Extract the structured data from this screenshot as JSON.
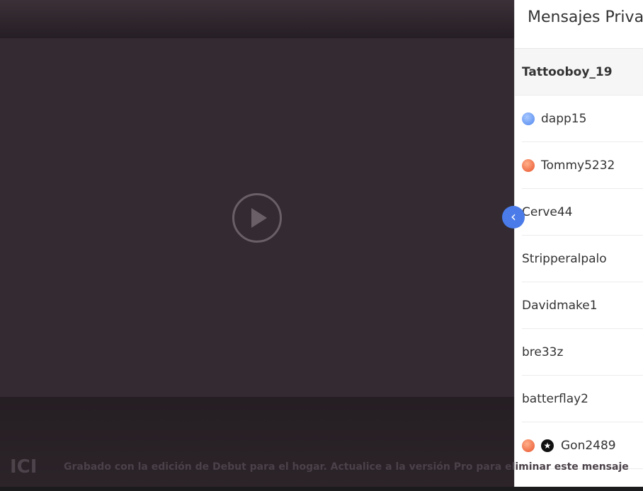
{
  "panel": {
    "title": "Mensajes Privados",
    "items": [
      {
        "name": "Tattooboy_19",
        "active": true,
        "dot": null,
        "badge": null
      },
      {
        "name": "dapp15",
        "active": false,
        "dot": "blue",
        "badge": null
      },
      {
        "name": "Tommy5232",
        "active": false,
        "dot": "orange",
        "badge": null
      },
      {
        "name": "Cerve44",
        "active": false,
        "dot": null,
        "badge": null
      },
      {
        "name": "Stripperalpalo",
        "active": false,
        "dot": null,
        "badge": null
      },
      {
        "name": "Davidmake1",
        "active": false,
        "dot": null,
        "badge": null
      },
      {
        "name": "bre33z",
        "active": false,
        "dot": null,
        "badge": null
      },
      {
        "name": "batterflay2",
        "active": false,
        "dot": null,
        "badge": null
      },
      {
        "name": "Gon2489",
        "active": false,
        "dot": "orange",
        "badge": "star"
      }
    ]
  },
  "collapse_button": {
    "glyph": "‹"
  },
  "watermark": {
    "logo": "ICI",
    "text": "Grabado con la edición de Debut para el hogar. Actualice a la versión Pro para eliminar este mensaje"
  },
  "colors": {
    "accent": "#4a7be8",
    "dot_blue": "#4f86ee",
    "dot_orange": "#e8522c"
  }
}
